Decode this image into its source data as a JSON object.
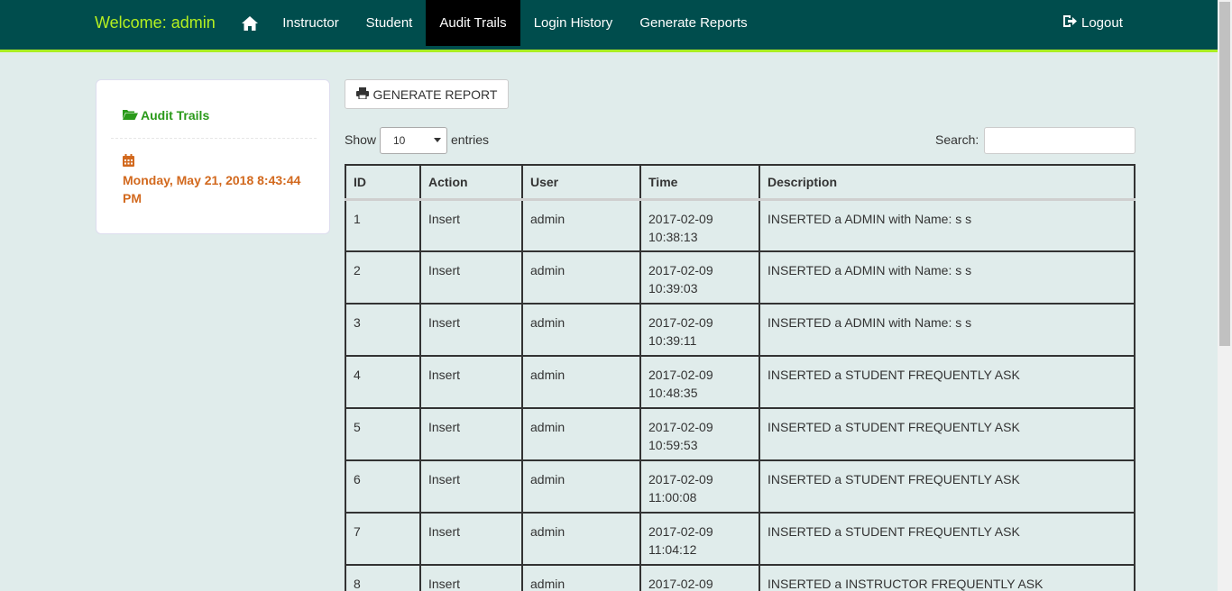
{
  "navbar": {
    "brand": "Welcome: admin",
    "items": [
      {
        "label": "Instructor"
      },
      {
        "label": "Student"
      },
      {
        "label": "Audit Trails"
      },
      {
        "label": "Login History"
      },
      {
        "label": "Generate Reports"
      }
    ],
    "logout": "Logout",
    "colors": {
      "bg": "#004d4d",
      "accent": "#aaee22",
      "active": "#000000"
    }
  },
  "sidebar": {
    "link": "Audit Trails",
    "date": "Monday, May 21, 2018 8:43:44 PM"
  },
  "toolbar": {
    "generate_report": "GENERATE REPORT",
    "show_label": "Show",
    "entries_value": "10",
    "entries_label": "entries",
    "search_label": "Search:",
    "search_value": ""
  },
  "table": {
    "columns": [
      "ID",
      "Action",
      "User",
      "Time",
      "Description"
    ],
    "rows": [
      {
        "id": "1",
        "action": "Insert",
        "user": "admin",
        "date": "2017-02-09",
        "time": "10:38:13",
        "description": "INSERTED a ADMIN with Name: s s"
      },
      {
        "id": "2",
        "action": "Insert",
        "user": "admin",
        "date": "2017-02-09",
        "time": "10:39:03",
        "description": "INSERTED a ADMIN with Name: s s"
      },
      {
        "id": "3",
        "action": "Insert",
        "user": "admin",
        "date": "2017-02-09",
        "time": "10:39:11",
        "description": "INSERTED a ADMIN with Name: s s"
      },
      {
        "id": "4",
        "action": "Insert",
        "user": "admin",
        "date": "2017-02-09",
        "time": "10:48:35",
        "description": "INSERTED a STUDENT FREQUENTLY ASK"
      },
      {
        "id": "5",
        "action": "Insert",
        "user": "admin",
        "date": "2017-02-09",
        "time": "10:59:53",
        "description": "INSERTED a STUDENT FREQUENTLY ASK"
      },
      {
        "id": "6",
        "action": "Insert",
        "user": "admin",
        "date": "2017-02-09",
        "time": "11:00:08",
        "description": "INSERTED a STUDENT FREQUENTLY ASK"
      },
      {
        "id": "7",
        "action": "Insert",
        "user": "admin",
        "date": "2017-02-09",
        "time": "11:04:12",
        "description": "INSERTED a STUDENT FREQUENTLY ASK"
      },
      {
        "id": "8",
        "action": "Insert",
        "user": "admin",
        "date": "2017-02-09",
        "time": "",
        "description": "INSERTED a INSTRUCTOR FREQUENTLY ASK"
      }
    ]
  }
}
